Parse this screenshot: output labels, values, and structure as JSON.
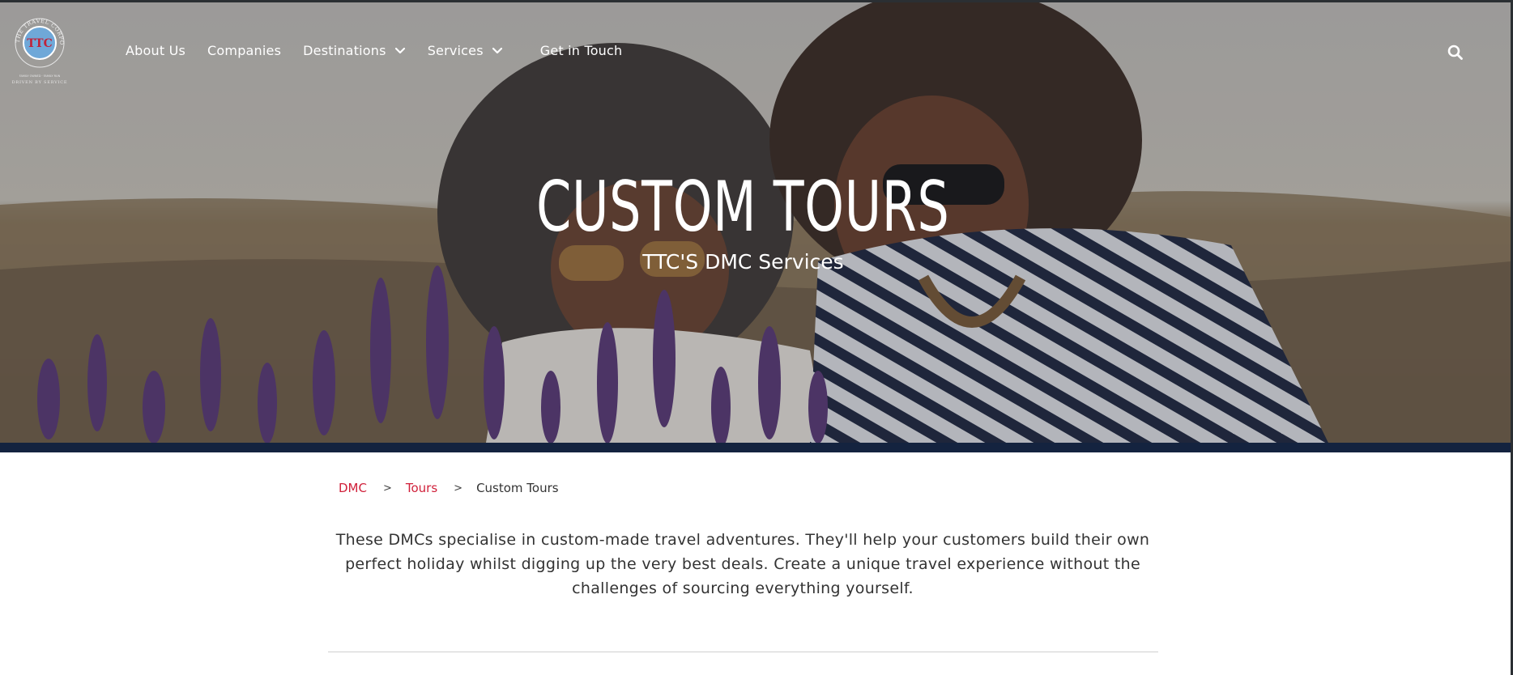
{
  "header": {
    "logo": {
      "initials": "TTC",
      "ring_text": "THE TRAVEL CORPORATION",
      "tagline_small": "FAMILY OWNED · FAMILY RUN",
      "tagline": "DRIVEN BY SERVICE"
    },
    "nav": {
      "about": "About Us",
      "companies": "Companies",
      "destinations": "Destinations",
      "services": "Services",
      "contact": "Get in Touch"
    },
    "search_icon": "search-icon",
    "dropdown_icon": "chevron-down-icon"
  },
  "hero": {
    "title": "CUSTOM TOURS",
    "subtitle": "TTC'S DMC Services"
  },
  "breadcrumb": {
    "items": [
      "DMC",
      "Tours",
      "Custom Tours"
    ],
    "separator": ">"
  },
  "intro": {
    "text": "These DMCs specialise in custom-made travel adventures. They'll help your customers build their own perfect holiday whilst digging up the very best deals. Create a unique travel experience without the challenges of sourcing everything yourself."
  },
  "colors": {
    "link_red": "#d0203a",
    "hero_band": "#14233f",
    "text": "#333333"
  }
}
